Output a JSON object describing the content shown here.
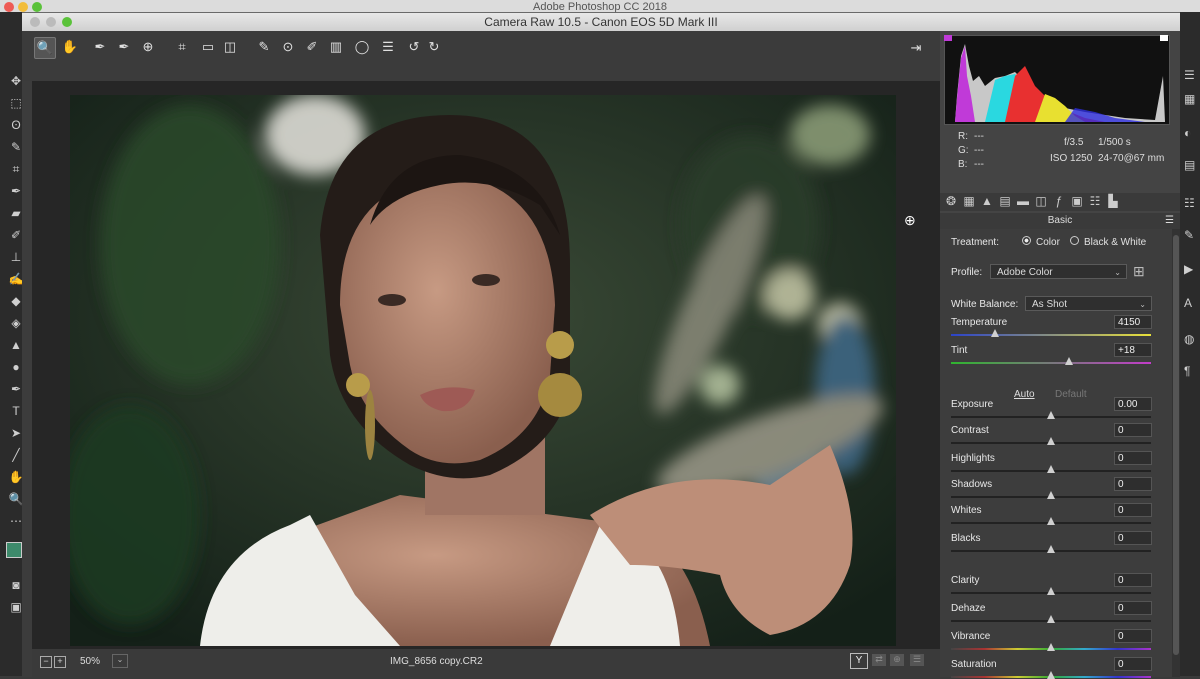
{
  "app": {
    "ps_title": "Adobe Photoshop CC 2018",
    "window_title": "Camera Raw 10.5  -  Canon EOS 5D Mark III"
  },
  "toolbar": {
    "tools": [
      {
        "icon": "zoom-icon",
        "glyph": "🔍",
        "active": true
      },
      {
        "icon": "hand-icon",
        "glyph": "✋"
      },
      {
        "icon": "white-balance-icon",
        "glyph": "✒"
      },
      {
        "icon": "color-sampler-icon",
        "glyph": "✒"
      },
      {
        "icon": "target-adjust-icon",
        "glyph": "⊕"
      },
      {
        "icon": "crop-icon",
        "glyph": "⌗"
      },
      {
        "icon": "straighten-icon",
        "glyph": "▭"
      },
      {
        "icon": "transform-icon",
        "glyph": "◫"
      },
      {
        "icon": "spot-removal-icon",
        "glyph": "✎"
      },
      {
        "icon": "red-eye-icon",
        "glyph": "⊙"
      },
      {
        "icon": "adjustment-brush-icon",
        "glyph": "✐"
      },
      {
        "icon": "graduated-filter-icon",
        "glyph": "▥"
      },
      {
        "icon": "radial-filter-icon",
        "glyph": "◯"
      },
      {
        "icon": "preferences-icon",
        "glyph": "☰"
      },
      {
        "icon": "rotate-ccw-icon",
        "glyph": "↺"
      },
      {
        "icon": "rotate-cw-icon",
        "glyph": "↻"
      }
    ],
    "export_icon": "open-export-icon"
  },
  "status": {
    "zoom": "50%",
    "filename": "IMG_8656 copy.CR2",
    "y_button": "Y"
  },
  "info": {
    "r_label": "R:",
    "g_label": "G:",
    "b_label": "B:",
    "r_val": "---",
    "g_val": "---",
    "b_val": "---",
    "aperture": "f/3.5",
    "shutter": "1/500 s",
    "iso": "ISO 1250",
    "lens": "24-70@67 mm"
  },
  "panel": {
    "title": "Basic",
    "treatment_label": "Treatment:",
    "treatment_color": "Color",
    "treatment_bw": "Black & White",
    "profile_label": "Profile:",
    "profile_value": "Adobe Color",
    "wb_label": "White Balance:",
    "wb_value": "As Shot",
    "auto": "Auto",
    "default": "Default",
    "sliders": [
      {
        "label": "Temperature",
        "value": "4150",
        "fraction": 0.22
      },
      {
        "label": "Tint",
        "value": "+18",
        "fraction": 0.59
      },
      {
        "label": "Exposure",
        "value": "0.00",
        "fraction": 0.5
      },
      {
        "label": "Contrast",
        "value": "0",
        "fraction": 0.5
      },
      {
        "label": "Highlights",
        "value": "0",
        "fraction": 0.5
      },
      {
        "label": "Shadows",
        "value": "0",
        "fraction": 0.5
      },
      {
        "label": "Whites",
        "value": "0",
        "fraction": 0.5
      },
      {
        "label": "Blacks",
        "value": "0",
        "fraction": 0.5
      },
      {
        "label": "Clarity",
        "value": "0",
        "fraction": 0.5
      },
      {
        "label": "Dehaze",
        "value": "0",
        "fraction": 0.5
      },
      {
        "label": "Vibrance",
        "value": "0",
        "fraction": 0.5
      },
      {
        "label": "Saturation",
        "value": "0",
        "fraction": 0.5
      }
    ]
  },
  "colors": {
    "temp_start": "#2b43c9",
    "temp_end": "#e8e03a",
    "tint_start": "#2fb52f",
    "tint_end": "#c23cc9",
    "foreground_swatch": "#3d8a6b"
  }
}
